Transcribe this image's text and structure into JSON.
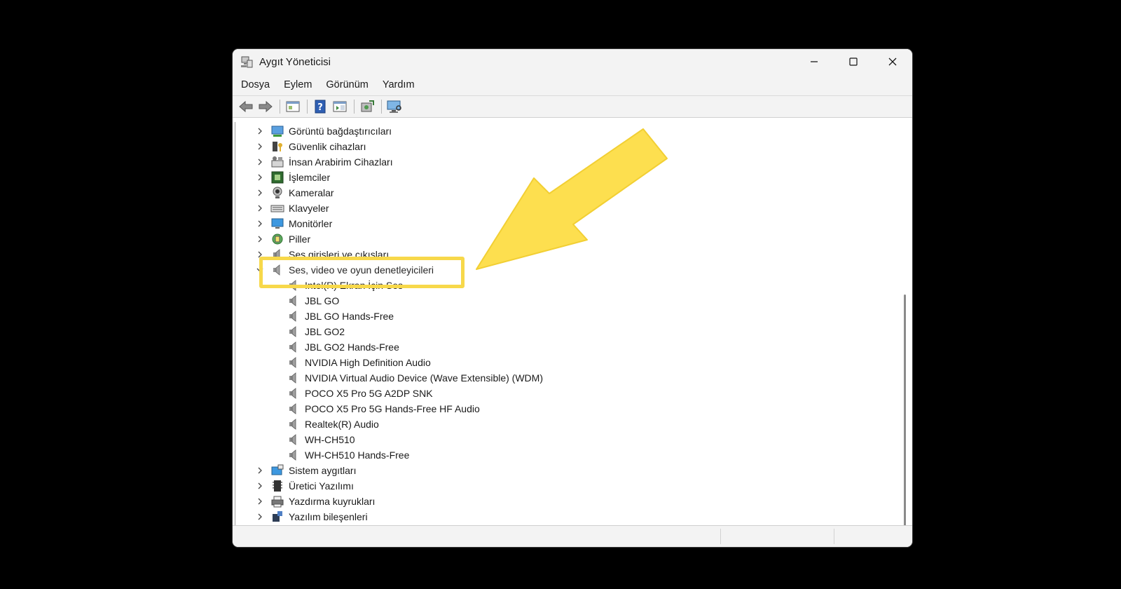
{
  "window": {
    "title": "Aygıt Yöneticisi",
    "controls": {
      "minimize": "—",
      "maximize": "☐",
      "close": "✕"
    }
  },
  "menu": [
    "Dosya",
    "Eylem",
    "Görünüm",
    "Yardım"
  ],
  "toolbar": [
    "back-icon",
    "forward-icon",
    "console-tree-icon",
    "help-icon",
    "action-pane-icon",
    "update-driver-icon",
    "scan-hardware-icon"
  ],
  "tree": [
    {
      "label": "Görüntü bağdaştırıcıları",
      "icon": "display-adapter-icon",
      "level": 0,
      "expanded": false
    },
    {
      "label": "Güvenlik cihazları",
      "icon": "security-device-icon",
      "level": 0,
      "expanded": false
    },
    {
      "label": "İnsan Arabirim Cihazları",
      "icon": "hid-icon",
      "level": 0,
      "expanded": false
    },
    {
      "label": "İşlemciler",
      "icon": "processor-icon",
      "level": 0,
      "expanded": false
    },
    {
      "label": "Kameralar",
      "icon": "camera-icon",
      "level": 0,
      "expanded": false
    },
    {
      "label": "Klavyeler",
      "icon": "keyboard-icon",
      "level": 0,
      "expanded": false
    },
    {
      "label": "Monitörler",
      "icon": "monitor-icon",
      "level": 0,
      "expanded": false
    },
    {
      "label": "Piller",
      "icon": "battery-icon",
      "level": 0,
      "expanded": false
    },
    {
      "label": "Ses girişleri ve çıkışları",
      "icon": "speaker-icon",
      "level": 0,
      "expanded": false
    },
    {
      "label": "Ses, video ve oyun denetleyicileri",
      "icon": "speaker-icon",
      "level": 0,
      "expanded": true
    },
    {
      "label": "Intel(R) Ekran İçin Ses",
      "icon": "speaker-icon",
      "level": 1
    },
    {
      "label": "JBL GO",
      "icon": "speaker-icon",
      "level": 1
    },
    {
      "label": "JBL GO Hands-Free",
      "icon": "speaker-icon",
      "level": 1
    },
    {
      "label": "JBL GO2",
      "icon": "speaker-icon",
      "level": 1
    },
    {
      "label": "JBL GO2 Hands-Free",
      "icon": "speaker-icon",
      "level": 1
    },
    {
      "label": "NVIDIA High Definition Audio",
      "icon": "speaker-icon",
      "level": 1
    },
    {
      "label": "NVIDIA Virtual Audio Device (Wave Extensible) (WDM)",
      "icon": "speaker-icon",
      "level": 1
    },
    {
      "label": "POCO X5 Pro 5G A2DP SNK",
      "icon": "speaker-icon",
      "level": 1
    },
    {
      "label": "POCO X5 Pro 5G Hands-Free HF Audio",
      "icon": "speaker-icon",
      "level": 1
    },
    {
      "label": "Realtek(R) Audio",
      "icon": "speaker-icon",
      "level": 1
    },
    {
      "label": "WH-CH510",
      "icon": "speaker-icon",
      "level": 1
    },
    {
      "label": "WH-CH510 Hands-Free",
      "icon": "speaker-icon",
      "level": 1
    },
    {
      "label": "Sistem aygıtları",
      "icon": "system-device-icon",
      "level": 0,
      "expanded": false
    },
    {
      "label": "Üretici Yazılımı",
      "icon": "firmware-icon",
      "level": 0,
      "expanded": false
    },
    {
      "label": "Yazdırma kuyrukları",
      "icon": "printer-icon",
      "level": 0,
      "expanded": false
    },
    {
      "label": "Yazılım bileşenleri",
      "icon": "software-component-icon",
      "level": 0,
      "expanded": false
    }
  ],
  "colors": {
    "highlight": "#f7d84a",
    "arrow": "#fddf4f",
    "background": "#000000"
  }
}
